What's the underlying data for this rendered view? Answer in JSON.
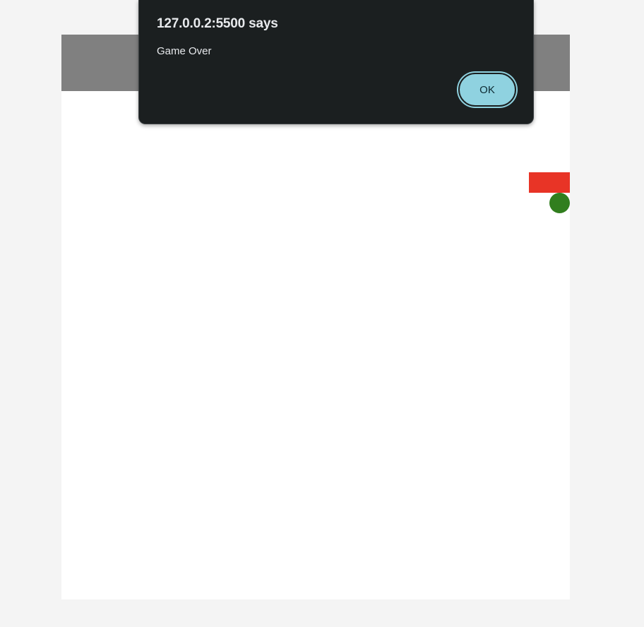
{
  "dialog": {
    "title": "127.0.0.2:5500 says",
    "message": "Game Over",
    "ok_label": "OK"
  },
  "game": {
    "header_color": "#808080",
    "board_color": "#ffffff",
    "snake_color": "#e83426",
    "food_color": "#317e1e"
  },
  "colors": {
    "page_background": "#f4f4f4",
    "dialog_background": "#1b1f20",
    "ok_button": "#8fd2e0"
  }
}
